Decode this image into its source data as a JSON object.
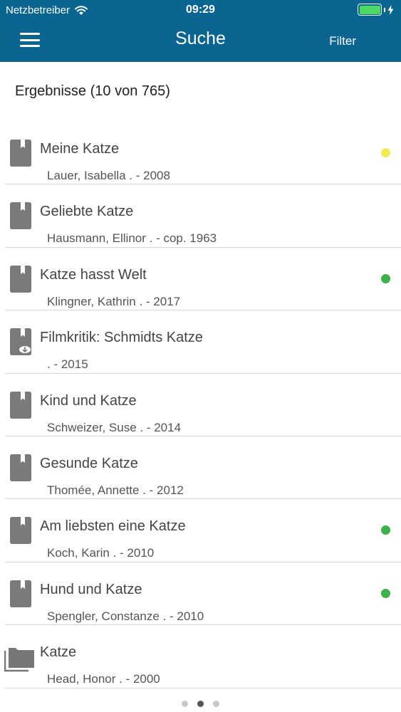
{
  "status_bar": {
    "carrier": "Netzbetreiber",
    "time": "09:29",
    "wifi_icon": "wifi-icon",
    "battery_icon": "battery-icon",
    "charging_icon": "charging-bolt-icon"
  },
  "nav": {
    "menu_icon": "hamburger-menu-icon",
    "title": "Suche",
    "filter_label": "Filter",
    "bar_color": "#0a6591"
  },
  "results": {
    "header": "Ergebnisse (10 von 765)",
    "items": [
      {
        "title": "Meine Katze",
        "subtitle": "Lauer, Isabella . - 2008",
        "icon": "book-icon",
        "status": "yellow",
        "status_color": "#f2ea4f"
      },
      {
        "title": "Geliebte Katze",
        "subtitle": "Hausmann, Ellinor . - cop. 1963",
        "icon": "book-icon",
        "status": "none",
        "status_color": ""
      },
      {
        "title": "Katze hasst Welt",
        "subtitle": "Klingner, Kathrin . - 2017",
        "icon": "book-icon",
        "status": "green",
        "status_color": "#3db24a"
      },
      {
        "title": "Filmkritik: Schmidts Katze",
        "subtitle": ". - 2015",
        "icon": "ebook-download-icon",
        "status": "none",
        "status_color": ""
      },
      {
        "title": "Kind und Katze",
        "subtitle": "Schweizer, Suse . - 2014",
        "icon": "book-icon",
        "status": "none",
        "status_color": ""
      },
      {
        "title": "Gesunde Katze",
        "subtitle": "Thomée, Annette . - 2012",
        "icon": "book-icon",
        "status": "none",
        "status_color": ""
      },
      {
        "title": "Am liebsten eine Katze",
        "subtitle": "Koch, Karin . - 2010",
        "icon": "book-icon",
        "status": "green",
        "status_color": "#3db24a"
      },
      {
        "title": "Hund und Katze",
        "subtitle": "Spengler, Constanze . - 2010",
        "icon": "book-icon",
        "status": "green",
        "status_color": "#3db24a"
      },
      {
        "title": "Katze",
        "subtitle": "Head, Honor . - 2000",
        "icon": "folder-stack-icon",
        "status": "none",
        "status_color": ""
      }
    ]
  },
  "pager": {
    "count": 3,
    "active_index": 1
  }
}
